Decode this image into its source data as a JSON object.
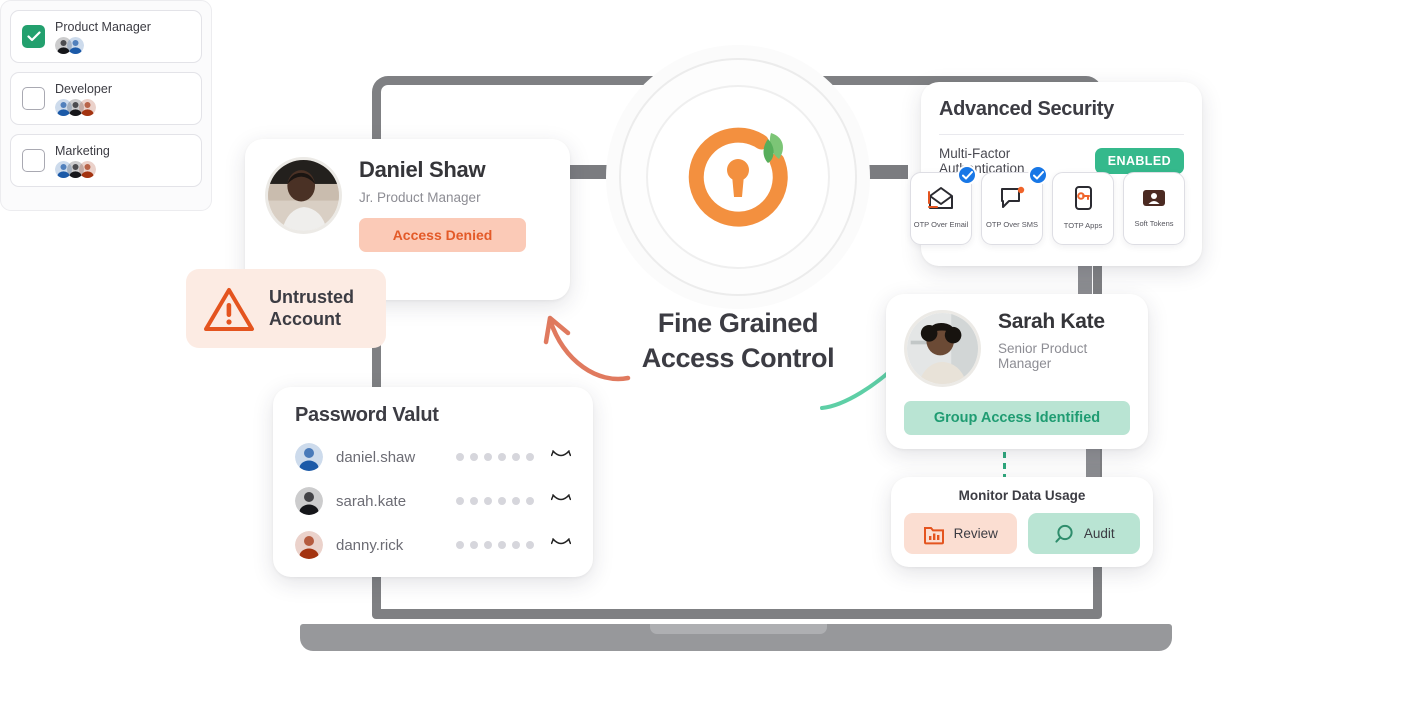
{
  "center": {
    "title_line1": "Fine Grained",
    "title_line2": "Access Control",
    "logo_icon": "padlock-keyhole-leaf-icon"
  },
  "daniel_card": {
    "name": "Daniel Shaw",
    "role": "Jr. Product Manager",
    "status_label": "Access Denied",
    "status_bg": "#fbcab7",
    "status_color": "#e35a28",
    "avatar_icon": "avatar-photo-daniel"
  },
  "untrusted_badge": {
    "line1": "Untrusted",
    "line2": "Account",
    "icon": "warning-triangle-icon",
    "bg": "#fcebe3",
    "icon_color": "#e35a28"
  },
  "vault": {
    "title": "Password Valut",
    "rows": [
      {
        "username": "daniel.shaw",
        "password_dots": 6,
        "eye_icon": "eye-closed-icon",
        "avatar_color": "#1c5aa8"
      },
      {
        "username": "sarah.kate",
        "password_dots": 6,
        "eye_icon": "eye-closed-icon",
        "avatar_color": "#15161a"
      },
      {
        "username": "danny.rick",
        "password_dots": 6,
        "eye_icon": "eye-closed-icon",
        "avatar_color": "#a33310"
      }
    ]
  },
  "roles": [
    {
      "label": "Product Manager",
      "checked": true,
      "member_colors": [
        "#15161a",
        "#1c5aa8"
      ]
    },
    {
      "label": "Developer",
      "checked": false,
      "member_colors": [
        "#1c5aa8",
        "#15161a",
        "#a33310"
      ]
    },
    {
      "label": "Marketing",
      "checked": false,
      "member_colors": [
        "#1c5aa8",
        "#15161a",
        "#a33310"
      ]
    }
  ],
  "security": {
    "title": "Advanced Security",
    "mfa_label": "Multi-Factor Authentication",
    "mfa_status": "ENABLED",
    "mfa_status_color": "#35b98c",
    "methods": [
      {
        "label": "OTP Over Email",
        "icon": "envelope-open-icon",
        "selected": true
      },
      {
        "label": "OTP Over SMS",
        "icon": "chat-bubble-dot-icon",
        "selected": true
      },
      {
        "label": "TOTP Apps",
        "icon": "phone-key-icon",
        "selected": false
      },
      {
        "label": "Soft Tokens",
        "icon": "token-badge-icon",
        "selected": false
      }
    ]
  },
  "sarah_card": {
    "name": "Sarah Kate",
    "role": "Senior Product Manager",
    "status_label": "Group Access Identified",
    "status_bg": "#b9e4d3",
    "status_color": "#1f9c72",
    "avatar_icon": "avatar-photo-sarah"
  },
  "monitor": {
    "title": "Monitor Data Usage",
    "buttons": [
      {
        "label": "Review",
        "icon": "bar-chart-folder-icon",
        "bg": "#fbded2"
      },
      {
        "label": "Audit",
        "icon": "magnifier-icon",
        "bg": "#b9e4d3"
      }
    ]
  },
  "arrows": {
    "left_arrow": "curved-arrow-coral-up-left",
    "right_arrow": "curved-arrow-green-up-right"
  }
}
